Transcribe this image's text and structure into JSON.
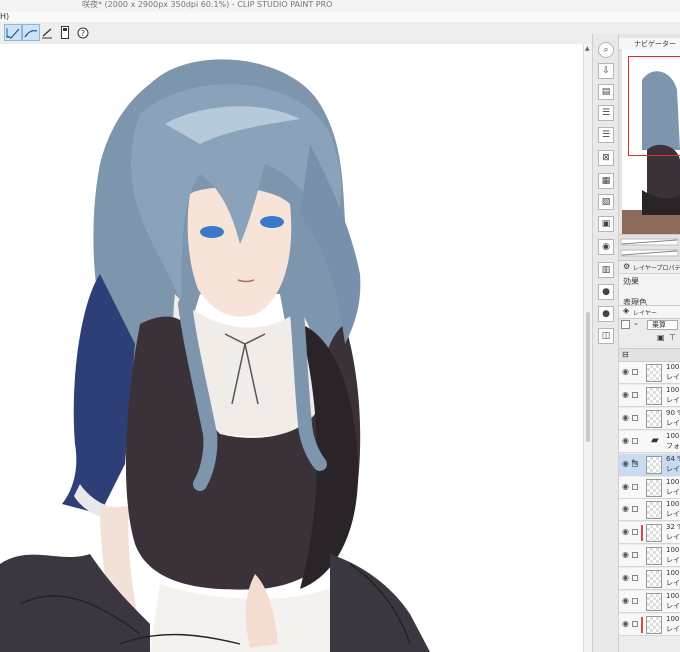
{
  "window": {
    "title": "咲夜* (2000 x 2900px 350dpi 60.1%) - CLIP STUDIO PAINT PRO"
  },
  "menubar": {
    "fragment": "H)"
  },
  "toolbar": {
    "tools": [
      {
        "icon": "brush-mode-icon",
        "active": true
      },
      {
        "icon": "line-mode-icon",
        "active": true
      },
      {
        "icon": "ruler-pen-icon",
        "active": false
      },
      {
        "icon": "device-icon",
        "active": false
      },
      {
        "icon": "help-icon",
        "active": false
      }
    ]
  },
  "side_icons": [
    "zoom-search-icon",
    "import-icon",
    "doc-icon",
    "list-icon",
    "list-icon",
    "layers-search-icon",
    "color-set-icon",
    "tone-icon",
    "material-icon",
    "camera-icon",
    "grid-icon",
    "palette-drop-icon",
    "palette-drop-icon",
    "info-icon"
  ],
  "navigator": {
    "tab_label": "ナビゲーター"
  },
  "properties": {
    "tab_label": "レイヤープロパティ",
    "effect_label": "効果",
    "expression_label": "表現色"
  },
  "layers": {
    "tab_label": "レイヤー",
    "blend_mode": "乗算",
    "rows": [
      {
        "pct": "100",
        "name": "レイ",
        "selected": false,
        "mask": false
      },
      {
        "pct": "100",
        "name": "レイ",
        "selected": false,
        "mask": false
      },
      {
        "pct": "90 %",
        "name": "レイ",
        "selected": false,
        "mask": false
      },
      {
        "pct": "100",
        "name": "フォ",
        "selected": false,
        "mask": false,
        "folder": true
      },
      {
        "pct": "64 %",
        "name": "レイ",
        "selected": true,
        "mask": false
      },
      {
        "pct": "100",
        "name": "レイ",
        "selected": false,
        "mask": false
      },
      {
        "pct": "100",
        "name": "レイ",
        "selected": false,
        "mask": false
      },
      {
        "pct": "32 %",
        "name": "レイ",
        "selected": false,
        "mask": true
      },
      {
        "pct": "100",
        "name": "レイ",
        "selected": false,
        "mask": false
      },
      {
        "pct": "100",
        "name": "レイ",
        "selected": false,
        "mask": false
      },
      {
        "pct": "100",
        "name": "レイ",
        "selected": false,
        "mask": false
      },
      {
        "pct": "100",
        "name": "レイ",
        "selected": false,
        "mask": true
      }
    ]
  },
  "colors": {
    "hair": "#7d95ad",
    "dress": "#3a3238",
    "sleeve": "#2e3f78",
    "eyes": "#3a78c8",
    "accent": "#c7dcf2"
  }
}
